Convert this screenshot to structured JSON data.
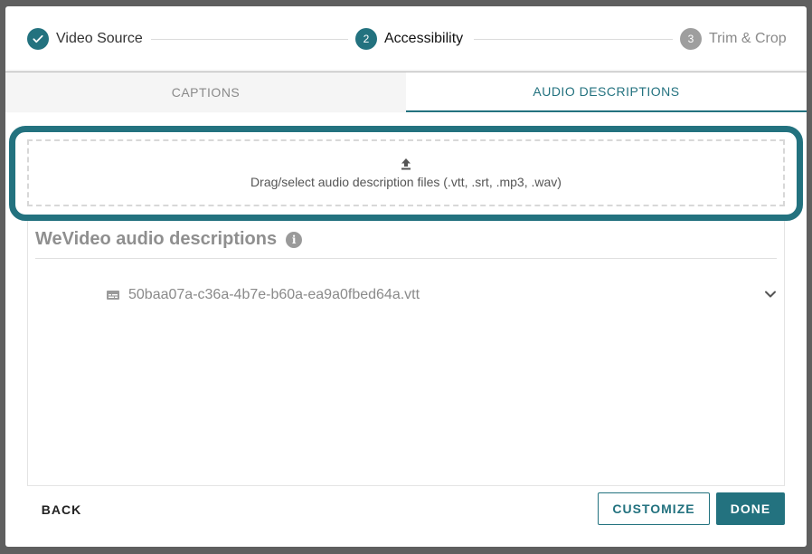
{
  "stepper": {
    "steps": [
      {
        "number": "",
        "label": "Video Source",
        "state": "done"
      },
      {
        "number": "2",
        "label": "Accessibility",
        "state": "active"
      },
      {
        "number": "3",
        "label": "Trim & Crop",
        "state": "todo"
      }
    ]
  },
  "tabs": {
    "captions": "CAPTIONS",
    "audio_descriptions": "AUDIO DESCRIPTIONS",
    "selected": "audio_descriptions"
  },
  "dropzone": {
    "text": "Drag/select audio description files (.vtt, .srt, .mp3, .wav)",
    "icon": "upload-icon"
  },
  "section": {
    "title": "WeVideo audio descriptions",
    "info_icon": "i"
  },
  "files": [
    {
      "name": "50baa07a-c36a-4b7e-b60a-ea9a0fbed64a.vtt",
      "icon": "closed-caption-icon"
    }
  ],
  "footer": {
    "back": "BACK",
    "customize": "CUSTOMIZE",
    "done": "DONE"
  },
  "colors": {
    "accent": "#23727f",
    "inactive": "#9e9e9e"
  }
}
